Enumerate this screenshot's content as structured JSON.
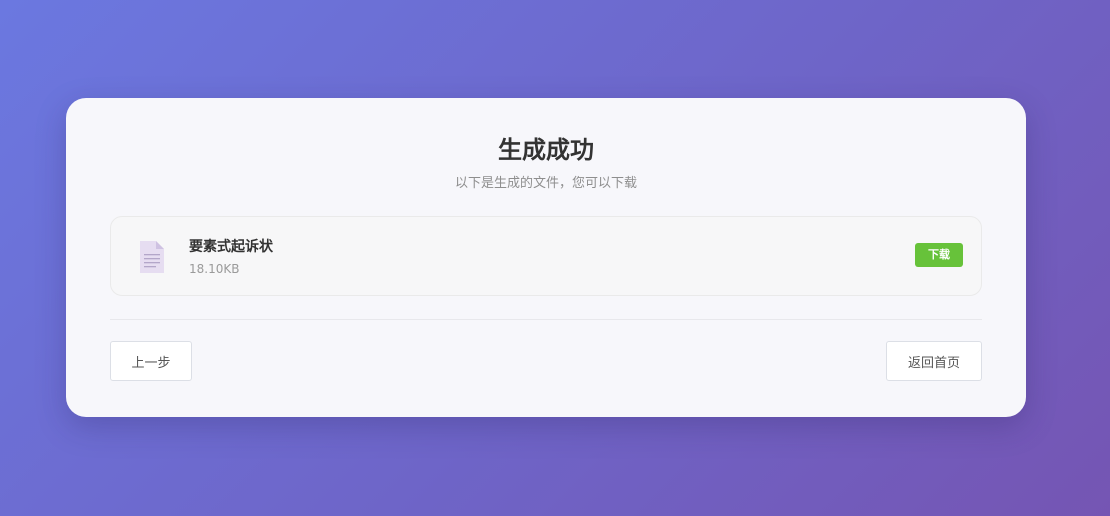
{
  "page": {
    "title": "生成成功",
    "subtitle": "以下是生成的文件，您可以下载"
  },
  "file": {
    "name": "要素式起诉状",
    "size": "18.10KB",
    "icon": "document-icon",
    "download_label": "下载"
  },
  "actions": {
    "prev_label": "上一步",
    "home_label": "返回首页"
  },
  "colors": {
    "download_button": "#67c23a",
    "file_icon": "#e4dcf0"
  }
}
